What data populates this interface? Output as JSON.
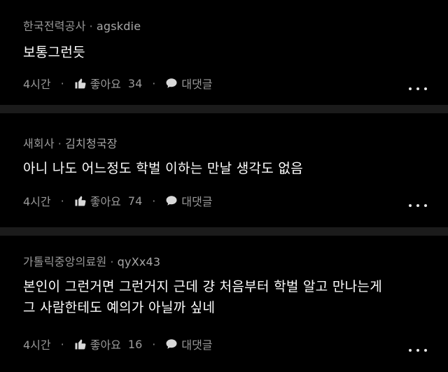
{
  "comments": [
    {
      "company": "한국전력공사",
      "separator": "·",
      "nickname": "agskdie",
      "lines": [
        "보통그런듯"
      ],
      "time": "4시간",
      "like_label": "좋아요",
      "like_count": "34",
      "reply_label": "대댓글"
    },
    {
      "company": "새회사",
      "separator": "·",
      "nickname": "김치청국장",
      "lines": [
        "아니 나도 어느정도 학벌 이하는 만날 생각도 없음"
      ],
      "time": "4시간",
      "like_label": "좋아요",
      "like_count": "74",
      "reply_label": "대댓글"
    },
    {
      "company": "가톨릭중앙의료원",
      "separator": "·",
      "nickname": "qyXx43",
      "lines": [
        "본인이 그런거면 그런거지 근데 걍 처음부터 학벌 알고 만나는게",
        "그 사람한테도 예의가 아닐까 싶네"
      ],
      "time": "4시간",
      "like_label": "좋아요",
      "like_count": "16",
      "reply_label": "대댓글"
    }
  ],
  "action_separator": "·",
  "icons": {
    "like": "thumbs-up-icon",
    "reply": "speech-bubble-icon",
    "more": "more-horizontal-icon"
  },
  "colors": {
    "background": "#000000",
    "divider": "#1b1b1b",
    "primary_text": "#ffffff",
    "secondary_text": "#9a9a9a"
  }
}
